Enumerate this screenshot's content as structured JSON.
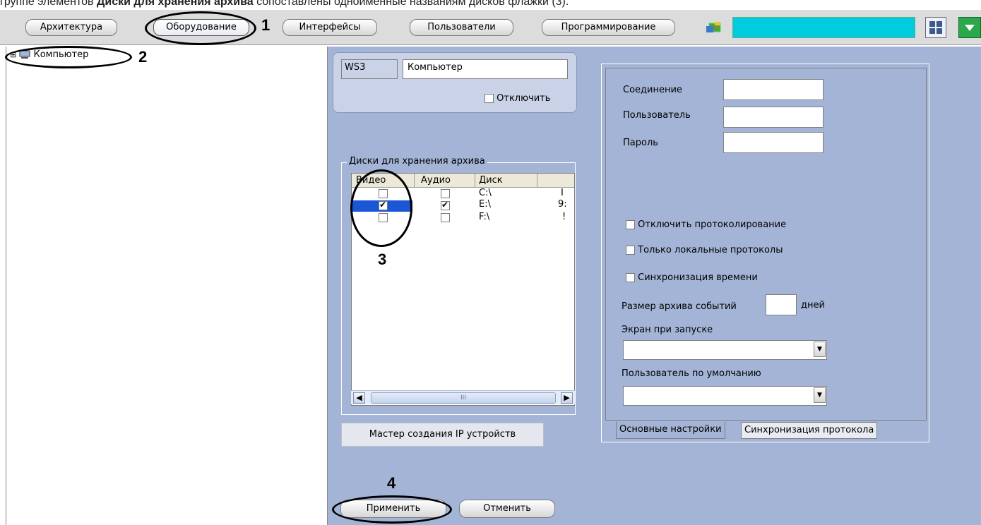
{
  "caption": {
    "pre": "группе элементов ",
    "bold": "Диски для хранения архива",
    "post": " сопоставлены одноимённые названиям дисков флажки (3)."
  },
  "tabs": [
    {
      "label": "Архитектура",
      "active": false
    },
    {
      "label": "Оборудование",
      "active": true
    },
    {
      "label": "Интерфейсы",
      "active": false
    },
    {
      "label": "Пользователи",
      "active": false
    },
    {
      "label": "Программирование",
      "active": false
    }
  ],
  "tree": {
    "root_label": "Компьютер"
  },
  "identity": {
    "id_value": "WS3",
    "name_value": "Компьютер",
    "disable_label": "Отключить"
  },
  "disks": {
    "legend": "Диски для хранения архива",
    "columns": [
      "Видео",
      "Аудио",
      "Диск"
    ],
    "rows": [
      {
        "video": false,
        "audio": false,
        "disk": "C:\\",
        "extra": "I"
      },
      {
        "video": true,
        "audio": true,
        "disk": "E:\\",
        "extra": "9:"
      },
      {
        "video": false,
        "audio": false,
        "disk": "F:\\",
        "extra": "!"
      }
    ],
    "scroll_grip": "III"
  },
  "wizard_button": "Мастер создания IP устройств",
  "settings": {
    "connection_label": "Соединение",
    "user_label": "Пользователь",
    "password_label": "Пароль",
    "disable_logging": "Отключить протоколирование",
    "local_logs_only": "Только локальные протоколы",
    "time_sync": "Синхронизация времени",
    "archive_size_label": "Размер архива событий",
    "archive_size_unit": "дней",
    "startup_screen_label": "Экран при запуске",
    "default_user_label": "Пользователь по умолчанию",
    "tab_main": "Основные настройки",
    "tab_sync": "Синхронизация протокола"
  },
  "actions": {
    "apply": "Применить",
    "cancel": "Отменить"
  },
  "annotations": {
    "n1": "1",
    "n2": "2",
    "n3": "3",
    "n4": "4"
  },
  "colors": {
    "panel": "#a4b4d6",
    "search": "#00ccdd",
    "selection": "#1a56d6"
  }
}
